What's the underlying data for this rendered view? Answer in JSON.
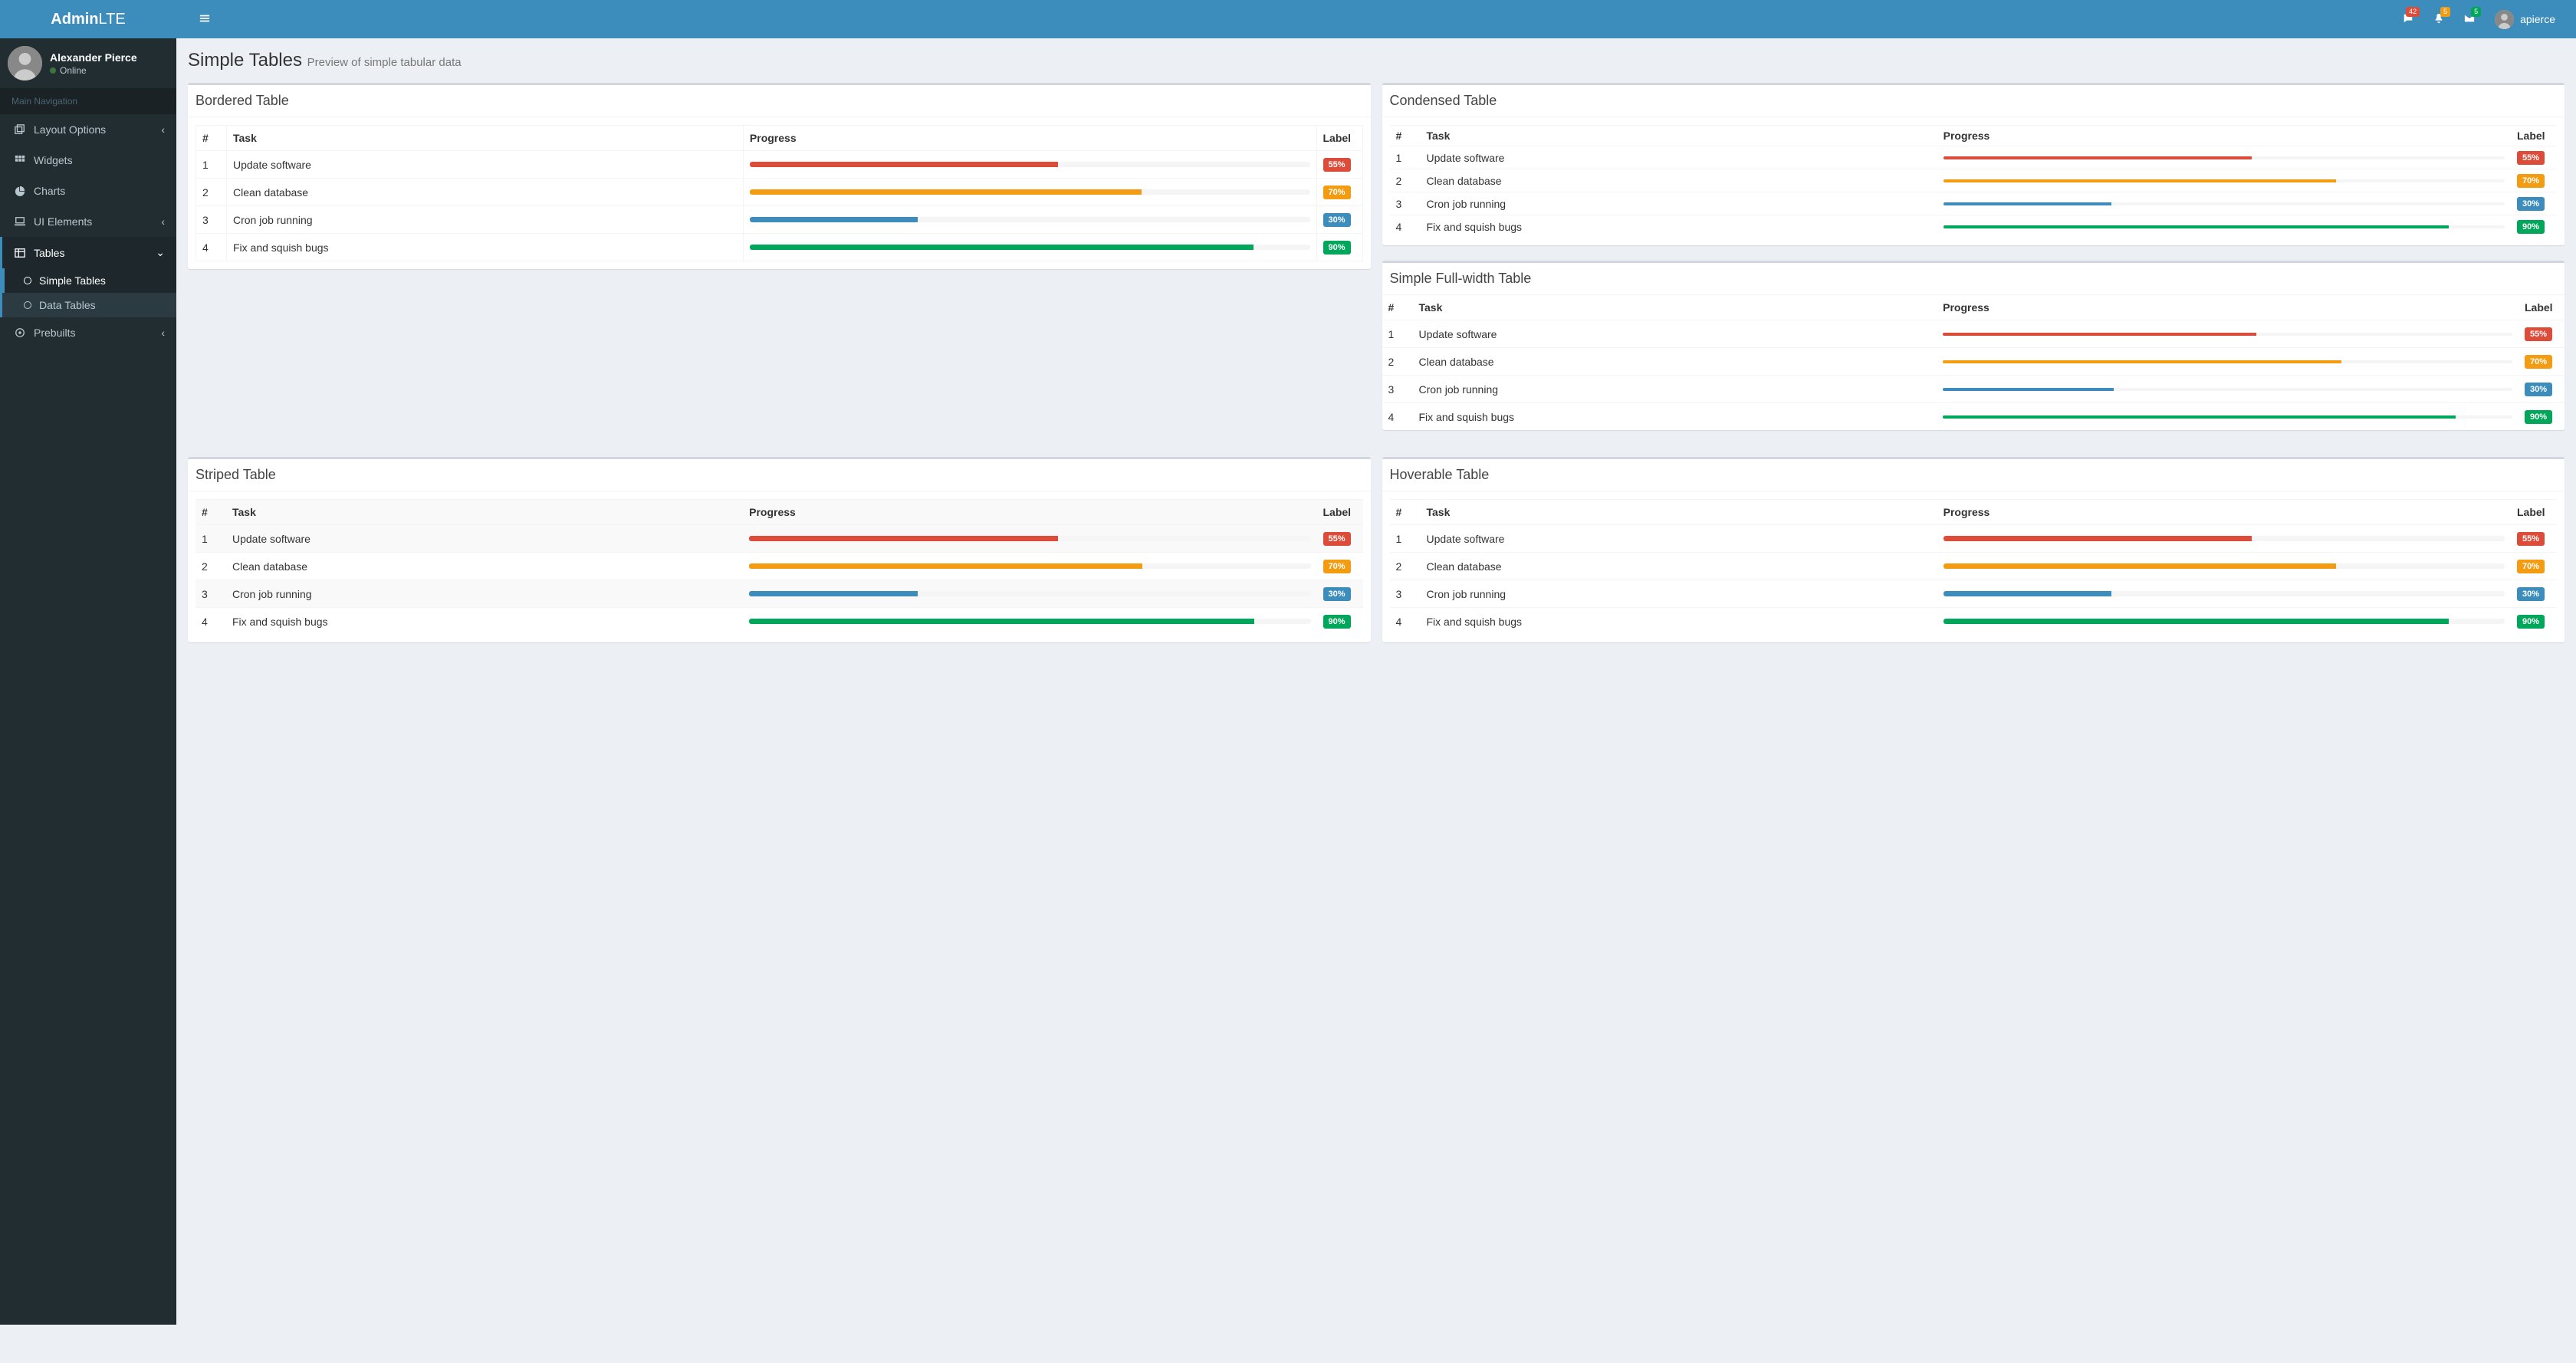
{
  "brand": {
    "bold": "Admin",
    "light": "LTE"
  },
  "header": {
    "badges": {
      "messages": "42",
      "notifications": "5",
      "mail": "5"
    },
    "username": "apierce"
  },
  "sidebar": {
    "user": {
      "name": "Alexander Pierce",
      "status": "Online"
    },
    "nav_header": "Main Navigation",
    "items": [
      {
        "label": "Layout Options",
        "icon": "clone"
      },
      {
        "label": "Widgets",
        "icon": "th"
      },
      {
        "label": "Charts",
        "icon": "pie"
      },
      {
        "label": "UI Elements",
        "icon": "laptop"
      },
      {
        "label": "Tables",
        "icon": "table"
      },
      {
        "label": "Prebuilts",
        "icon": "dot"
      }
    ],
    "tables_sub": [
      {
        "label": "Simple Tables"
      },
      {
        "label": "Data Tables"
      }
    ]
  },
  "page": {
    "title": "Simple Tables",
    "subtitle": "Preview of simple tabular data"
  },
  "tables": {
    "bordered": {
      "title": "Bordered Table"
    },
    "condensed": {
      "title": "Condensed Table"
    },
    "simple_full": {
      "title": "Simple Full-width Table"
    },
    "striped": {
      "title": "Striped Table"
    },
    "hoverable": {
      "title": "Hoverable Table"
    }
  },
  "columns": {
    "num": "#",
    "task": "Task",
    "progress": "Progress",
    "label": "Label"
  },
  "rows": [
    {
      "n": "1",
      "task": "Update software",
      "pct": 55,
      "badge": "55%",
      "color": "red"
    },
    {
      "n": "2",
      "task": "Clean database",
      "pct": 70,
      "badge": "70%",
      "color": "yellow"
    },
    {
      "n": "3",
      "task": "Cron job running",
      "pct": 30,
      "badge": "30%",
      "color": "blue"
    },
    {
      "n": "4",
      "task": "Fix and squish bugs",
      "pct": 90,
      "badge": "90%",
      "color": "green"
    }
  ]
}
